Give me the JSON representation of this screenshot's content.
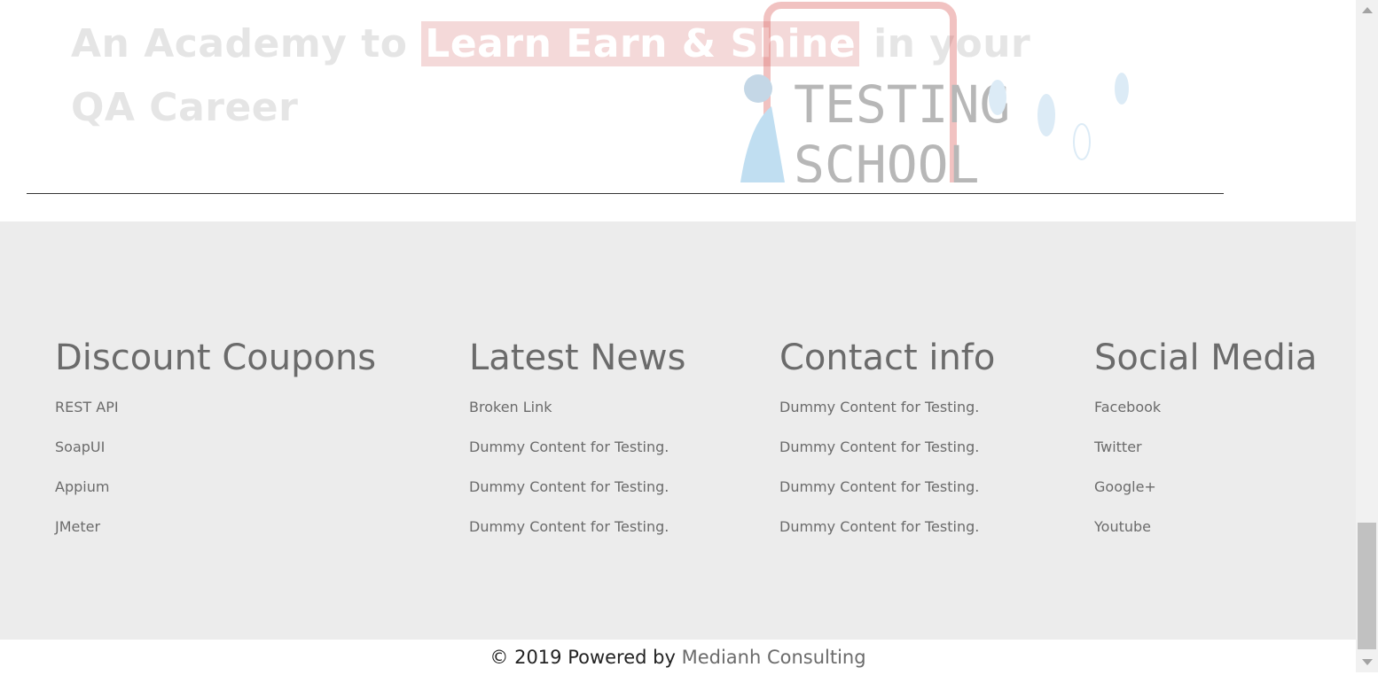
{
  "hero": {
    "title_part1": "An Academy to ",
    "title_highlight": "Learn Earn & Shine",
    "title_part2": "  in your QA Career",
    "illustration_text_1": "TESTING",
    "illustration_text_2": "SCHOOL"
  },
  "footer": {
    "columns": [
      {
        "heading": "Discount Coupons",
        "links": [
          "REST API",
          "SoapUI",
          "Appium",
          "JMeter"
        ]
      },
      {
        "heading": "Latest News",
        "links": [
          "Broken Link",
          "Dummy Content for Testing.",
          "Dummy Content for Testing.",
          "Dummy Content for Testing."
        ]
      },
      {
        "heading": "Contact info",
        "links": [
          "Dummy Content for Testing.",
          "Dummy Content for Testing.",
          "Dummy Content for Testing.",
          "Dummy Content for Testing."
        ]
      },
      {
        "heading": "Social Media",
        "links": [
          "Facebook",
          "Twitter",
          "Google+",
          "Youtube"
        ]
      }
    ]
  },
  "copyright": {
    "prefix": "© 2019 Powered by ",
    "link": "Medianh Consulting"
  },
  "colors": {
    "footer_bg": "#ececec",
    "footer_text": "#6b6b6b",
    "hero_text": "#e5e5e5",
    "highlight_bg": "#f4d9d9"
  }
}
